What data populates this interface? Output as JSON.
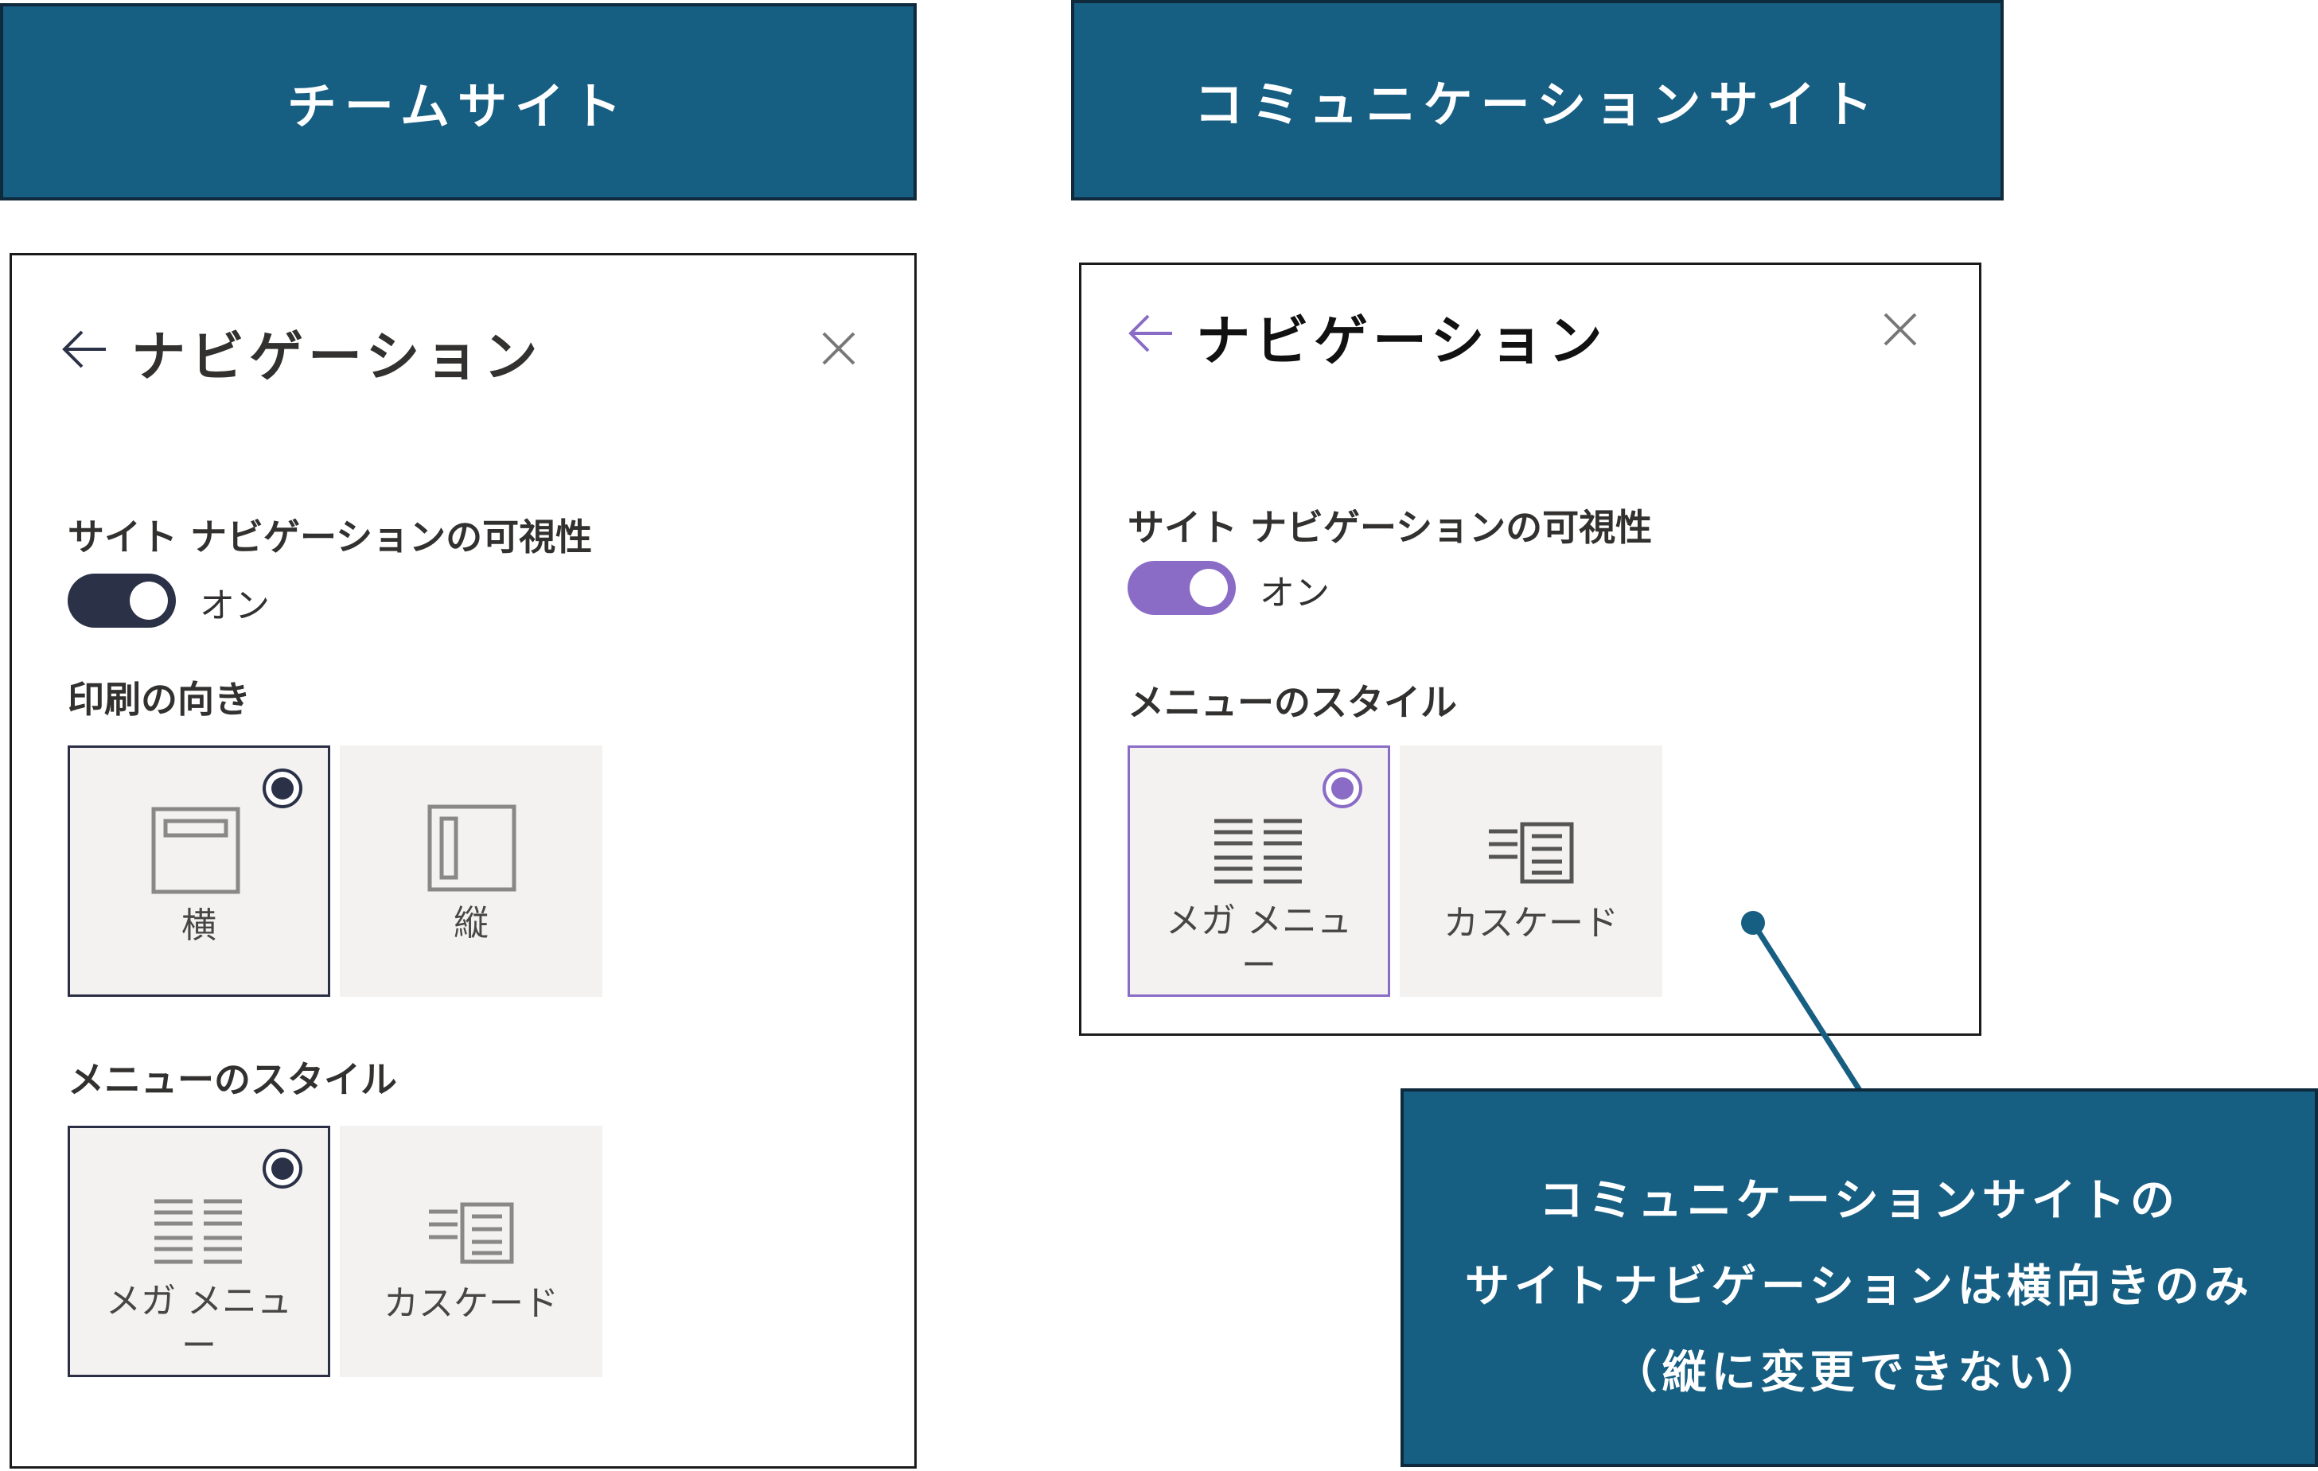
{
  "left": {
    "banner": "チームサイト",
    "panel": {
      "title": "ナビゲーション",
      "visibility_label": "サイト ナビゲーションの可視性",
      "toggle_state": "オン",
      "orientation_label": "印刷の向き",
      "orientation_options": [
        "横",
        "縦"
      ],
      "menu_style_label": "メニューのスタイル",
      "menu_options": [
        "メガ メニュー",
        "カスケード"
      ]
    }
  },
  "right": {
    "banner": "コミュニケーションサイト",
    "panel": {
      "title": "ナビゲーション",
      "visibility_label": "サイト ナビゲーションの可視性",
      "toggle_state": "オン",
      "menu_style_label": "メニューのスタイル",
      "menu_options": [
        "メガ メニュー",
        "カスケード"
      ]
    }
  },
  "callout": {
    "line1": "コミュニケーションサイトの",
    "line2": "サイトナビゲーションは横向きのみ",
    "line3": "（縦に変更できない）"
  },
  "colors": {
    "banner_bg": "#165e82",
    "toggle_dark": "#2b3147",
    "toggle_purple": "#8a6cc6",
    "option_bg": "#f3f2f1"
  },
  "icons": [
    "back-arrow-icon",
    "close-icon",
    "horizontal-layout-icon",
    "vertical-layout-icon",
    "mega-menu-icon",
    "cascade-icon"
  ]
}
